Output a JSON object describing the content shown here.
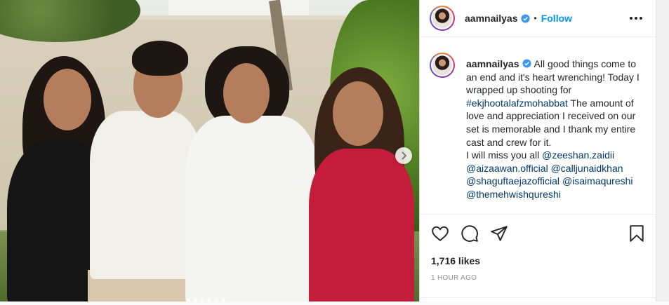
{
  "post": {
    "username": "aamnailyas",
    "follow_label": "Follow",
    "bullet": "•",
    "caption_text": "All good things come to an end and it's heart wrenching! Today I wrapped up shooting for",
    "hashtag": "#ekjhootalafzmohabbat",
    "caption_text2": "The amount of love and appreciation I received on our set is memorable and I thank my entire cast and crew for it.",
    "miss_line": "I will miss you all",
    "mentions": [
      "@zeeshan.zaidii",
      "@aizaawan.official",
      "@calljunaidkhan",
      "@shaguftaejazofficial",
      "@isaimaqureshi",
      "@themehwishqureshi"
    ],
    "likes": "1,716 likes",
    "time": "1 HOUR AGO",
    "carousel_slides": 6,
    "carousel_active": 1
  },
  "icons": {
    "verified": "verified-badge-icon",
    "more": "more-options-icon",
    "like": "heart-icon",
    "comment": "comment-icon",
    "share": "share-icon",
    "save": "bookmark-icon",
    "next": "chevron-right-icon"
  },
  "colors": {
    "link": "#00376b",
    "follow": "#0095f6",
    "verified": "#3897f0",
    "text": "#262626",
    "muted": "#8e8e8e"
  }
}
